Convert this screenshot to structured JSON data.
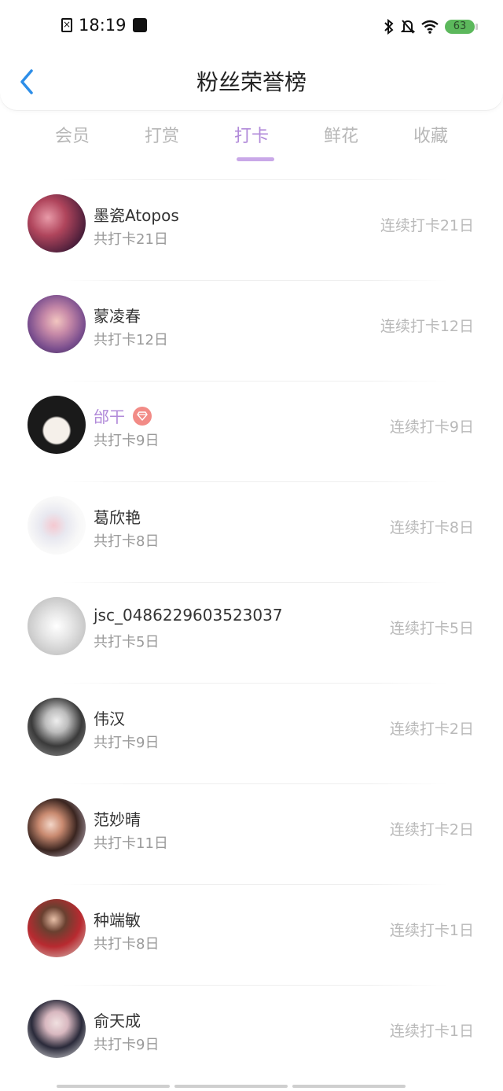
{
  "status_bar": {
    "time": "18:19",
    "battery": "63"
  },
  "header": {
    "title": "粉丝荣誉榜"
  },
  "tabs": [
    {
      "label": "会员",
      "active": false
    },
    {
      "label": "打赏",
      "active": false
    },
    {
      "label": "打卡",
      "active": true
    },
    {
      "label": "鲜花",
      "active": false
    },
    {
      "label": "收藏",
      "active": false
    }
  ],
  "colors": {
    "accent": "#b18ad9",
    "back_arrow": "#2d8ee8",
    "vip_badge": "#f28b86"
  },
  "fans": [
    {
      "name": "墨瓷Atopos",
      "total": "共打卡21日",
      "streak": "连续打卡21日",
      "vip": false
    },
    {
      "name": "蒙凌春",
      "total": "共打卡12日",
      "streak": "连续打卡12日",
      "vip": false
    },
    {
      "name": "邰干",
      "total": "共打卡9日",
      "streak": "连续打卡9日",
      "vip": true
    },
    {
      "name": "葛欣艳",
      "total": "共打卡8日",
      "streak": "连续打卡8日",
      "vip": false
    },
    {
      "name": "jsc_0486229603523037",
      "total": "共打卡5日",
      "streak": "连续打卡5日",
      "vip": false
    },
    {
      "name": "伟汉",
      "total": "共打卡9日",
      "streak": "连续打卡2日",
      "vip": false
    },
    {
      "name": "范妙晴",
      "total": "共打卡11日",
      "streak": "连续打卡2日",
      "vip": false
    },
    {
      "name": "种端敏",
      "total": "共打卡8日",
      "streak": "连续打卡1日",
      "vip": false
    },
    {
      "name": "俞天成",
      "total": "共打卡9日",
      "streak": "连续打卡1日",
      "vip": false
    }
  ]
}
